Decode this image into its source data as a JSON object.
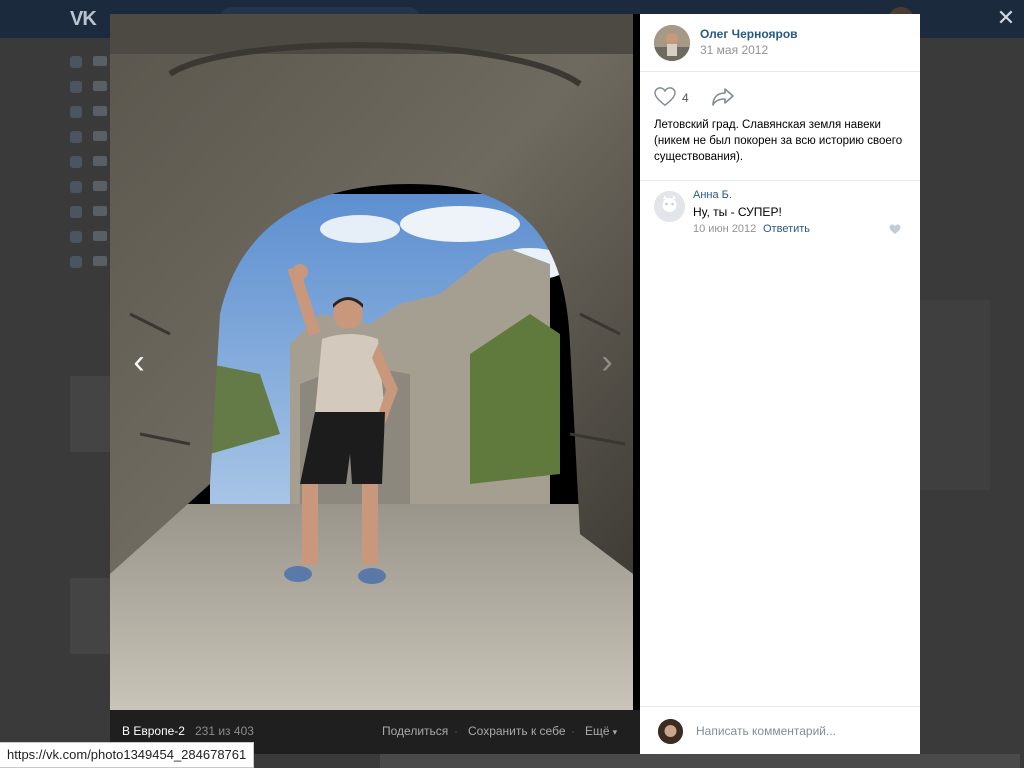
{
  "app": {
    "logo": "VK"
  },
  "viewer": {
    "album_name": "В Европе-2",
    "counter": "231 из 403",
    "actions": {
      "share": "Поделиться",
      "save": "Сохранить к себе",
      "more": "Ещё"
    },
    "prev_icon": "chevron-left-icon",
    "next_icon": "chevron-right-icon",
    "close_icon": "close-icon"
  },
  "post": {
    "author": "Олег Чернояров",
    "date": "31 мая 2012",
    "likes": "4",
    "caption": "Летовский град. Славянская земля навеки (никем не был покорен за всю историю своего существования)."
  },
  "comments": [
    {
      "author": "Анна Б.",
      "text": "Ну, ты - СУПЕР!",
      "date": "10 июн 2012",
      "reply": "Ответить"
    }
  ],
  "compose": {
    "placeholder": "Написать комментарий..."
  },
  "status_bar": {
    "url": "https://vk.com/photo1349454_284678761"
  },
  "colors": {
    "link": "#2a5885",
    "header": "#1c2a3d",
    "muted": "#939393"
  }
}
